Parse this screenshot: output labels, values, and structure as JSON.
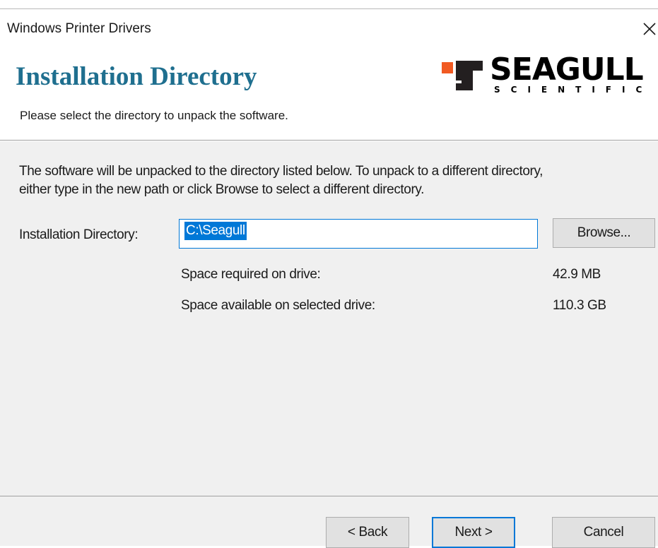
{
  "window": {
    "title": "Windows Printer Drivers",
    "close_icon": "close-icon"
  },
  "header": {
    "title": "Installation Directory",
    "subtitle": "Please select the directory to unpack the software.",
    "logo": {
      "word": "SEAGULL",
      "sub": "SCIENTIFIC",
      "mark_icon": "seagull-logo-mark-icon"
    }
  },
  "content": {
    "description_line1": "The software will be unpacked to the directory listed below.  To unpack to a different directory,",
    "description_line2": "either type in the new path or click Browse to select a different directory.",
    "directory_label": "Installation Directory:",
    "directory_value": "C:\\Seagull",
    "browse_label": "Browse...",
    "space_required_label": "Space required on drive:",
    "space_required_value": "42.9 MB",
    "space_available_label": "Space available on selected drive:",
    "space_available_value": "110.3 GB"
  },
  "footer": {
    "back_label": "< Back",
    "next_label": "Next >",
    "cancel_label": "Cancel"
  },
  "colors": {
    "title_teal": "#1f6f8f",
    "selection_blue": "#0078d7",
    "panel_gray": "#f0f0f0",
    "button_gray": "#e1e1e1",
    "logo_orange": "#f15a22"
  }
}
